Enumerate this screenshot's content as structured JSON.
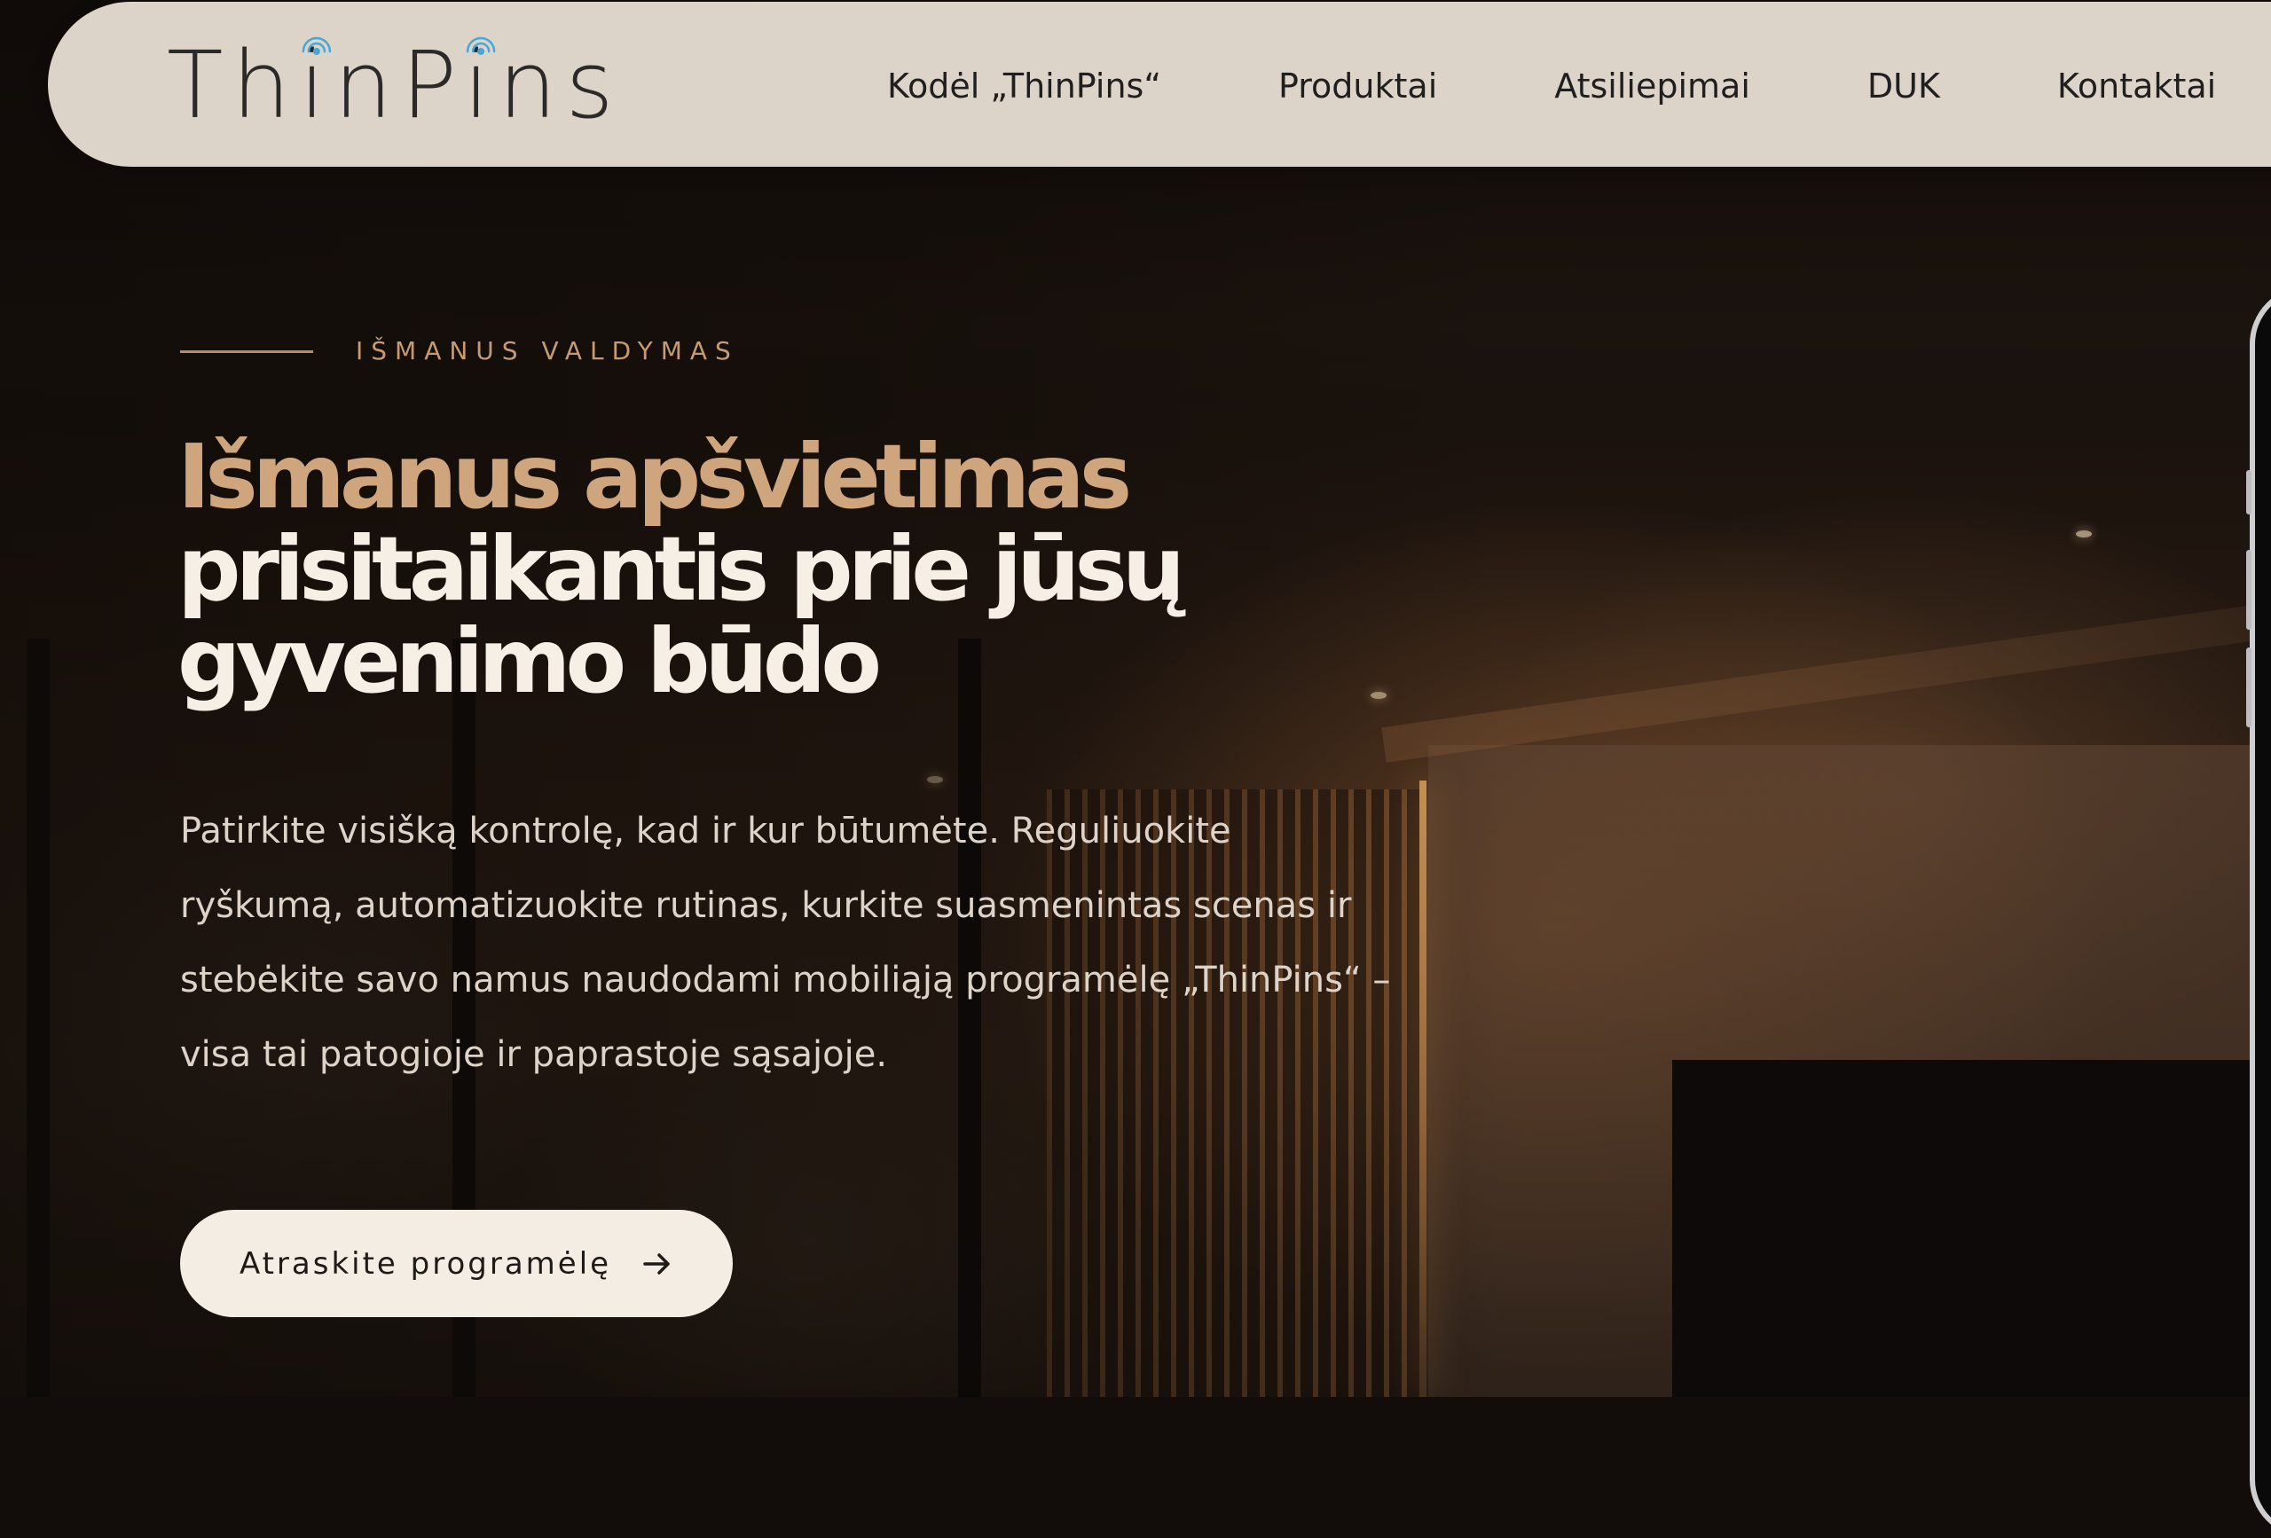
{
  "brand": {
    "logo_text": "ThinPins"
  },
  "nav": {
    "items": [
      {
        "label": "Kodėl „ThinPins“"
      },
      {
        "label": "Produktai"
      },
      {
        "label": "Atsiliepimai"
      },
      {
        "label": "DUK"
      },
      {
        "label": "Kontaktai"
      }
    ]
  },
  "hero": {
    "eyebrow": "IŠMANUS VALDYMAS",
    "headline_accent": "Išmanus apšvietimas",
    "headline_main": "prisitaikantis prie jūsų gyvenimo būdo",
    "description": "Patirkite visišką kontrolę, kad ir kur būtumėte. Reguliuokite ryškumą, automatizuokite rutinas, kurkite suasmenintas scenas ir stebėkite savo namus naudodami mobiliąją programėlę „ThinPins“ – visa tai patogioje ir paprastoje sąsajoje.",
    "cta_label": "Atraskite programėlę",
    "cta_icon": "arrow-right-icon"
  },
  "colors": {
    "header_bg": "#dcd4c8",
    "accent": "#cfa57e",
    "eyebrow": "#c79b72",
    "headline": "#f6efe6",
    "body_text": "#ddd3c8",
    "cta_bg": "#f4ede3",
    "logo_signal": "#4aa6d6"
  }
}
